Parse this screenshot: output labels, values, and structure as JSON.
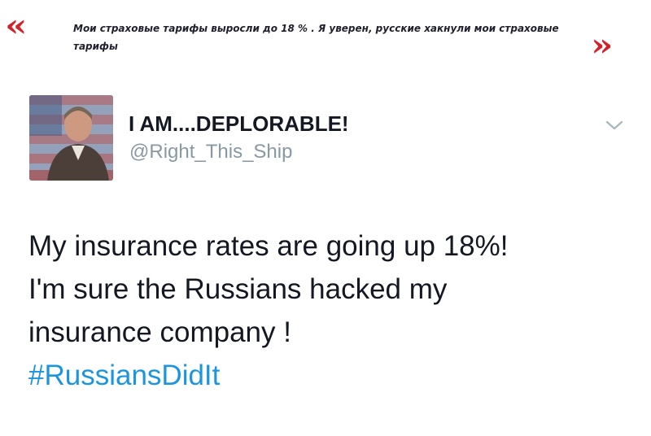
{
  "caption": {
    "open_quote": "«",
    "close_quote": "»",
    "text": "Мои страховые тарифы выросли до 18 % . Я уверен, русские хакнули мои страховые тарифы",
    "accent_color": "#d2232a"
  },
  "tweet": {
    "display_name": "I AM....DEPLORABLE!",
    "handle": "@Right_This_Ship",
    "avatar_icon": "user-avatar-flag-icon",
    "menu_icon": "chevron-down-icon",
    "text_lines": [
      "My insurance rates are going up 18%!",
      "I'm sure the Russians hacked my",
      "insurance company !"
    ],
    "hashtag": "#RussiansDidIt",
    "hashtag_color": "#1b95e0",
    "handle_color": "#8899a6"
  }
}
